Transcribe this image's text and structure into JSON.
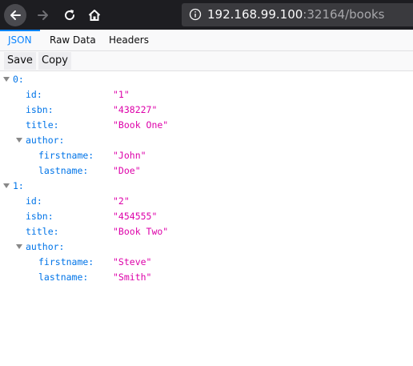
{
  "browser": {
    "url_host": "192.168.99.100",
    "url_rest": ":32164/books"
  },
  "tabs": [
    "JSON",
    "Raw Data",
    "Headers"
  ],
  "actions": {
    "save": "Save",
    "copy": "Copy"
  },
  "tree": {
    "item0": {
      "key": "0:",
      "id_key": "id:",
      "id_val": "\"1\"",
      "isbn_key": "isbn:",
      "isbn_val": "\"438227\"",
      "title_key": "title:",
      "title_val": "\"Book One\"",
      "author_key": "author:",
      "firstname_key": "firstname:",
      "firstname_val": "\"John\"",
      "lastname_key": "lastname:",
      "lastname_val": "\"Doe\""
    },
    "item1": {
      "key": "1:",
      "id_key": "id:",
      "id_val": "\"2\"",
      "isbn_key": "isbn:",
      "isbn_val": "\"454555\"",
      "title_key": "title:",
      "title_val": "\"Book Two\"",
      "author_key": "author:",
      "firstname_key": "firstname:",
      "firstname_val": "\"Steve\"",
      "lastname_key": "lastname:",
      "lastname_val": "\"Smith\""
    }
  },
  "colors": {
    "key": "#0074e8",
    "string": "#dd00a9",
    "accent": "#0a84ff",
    "toolbar": "#1d1d21"
  }
}
